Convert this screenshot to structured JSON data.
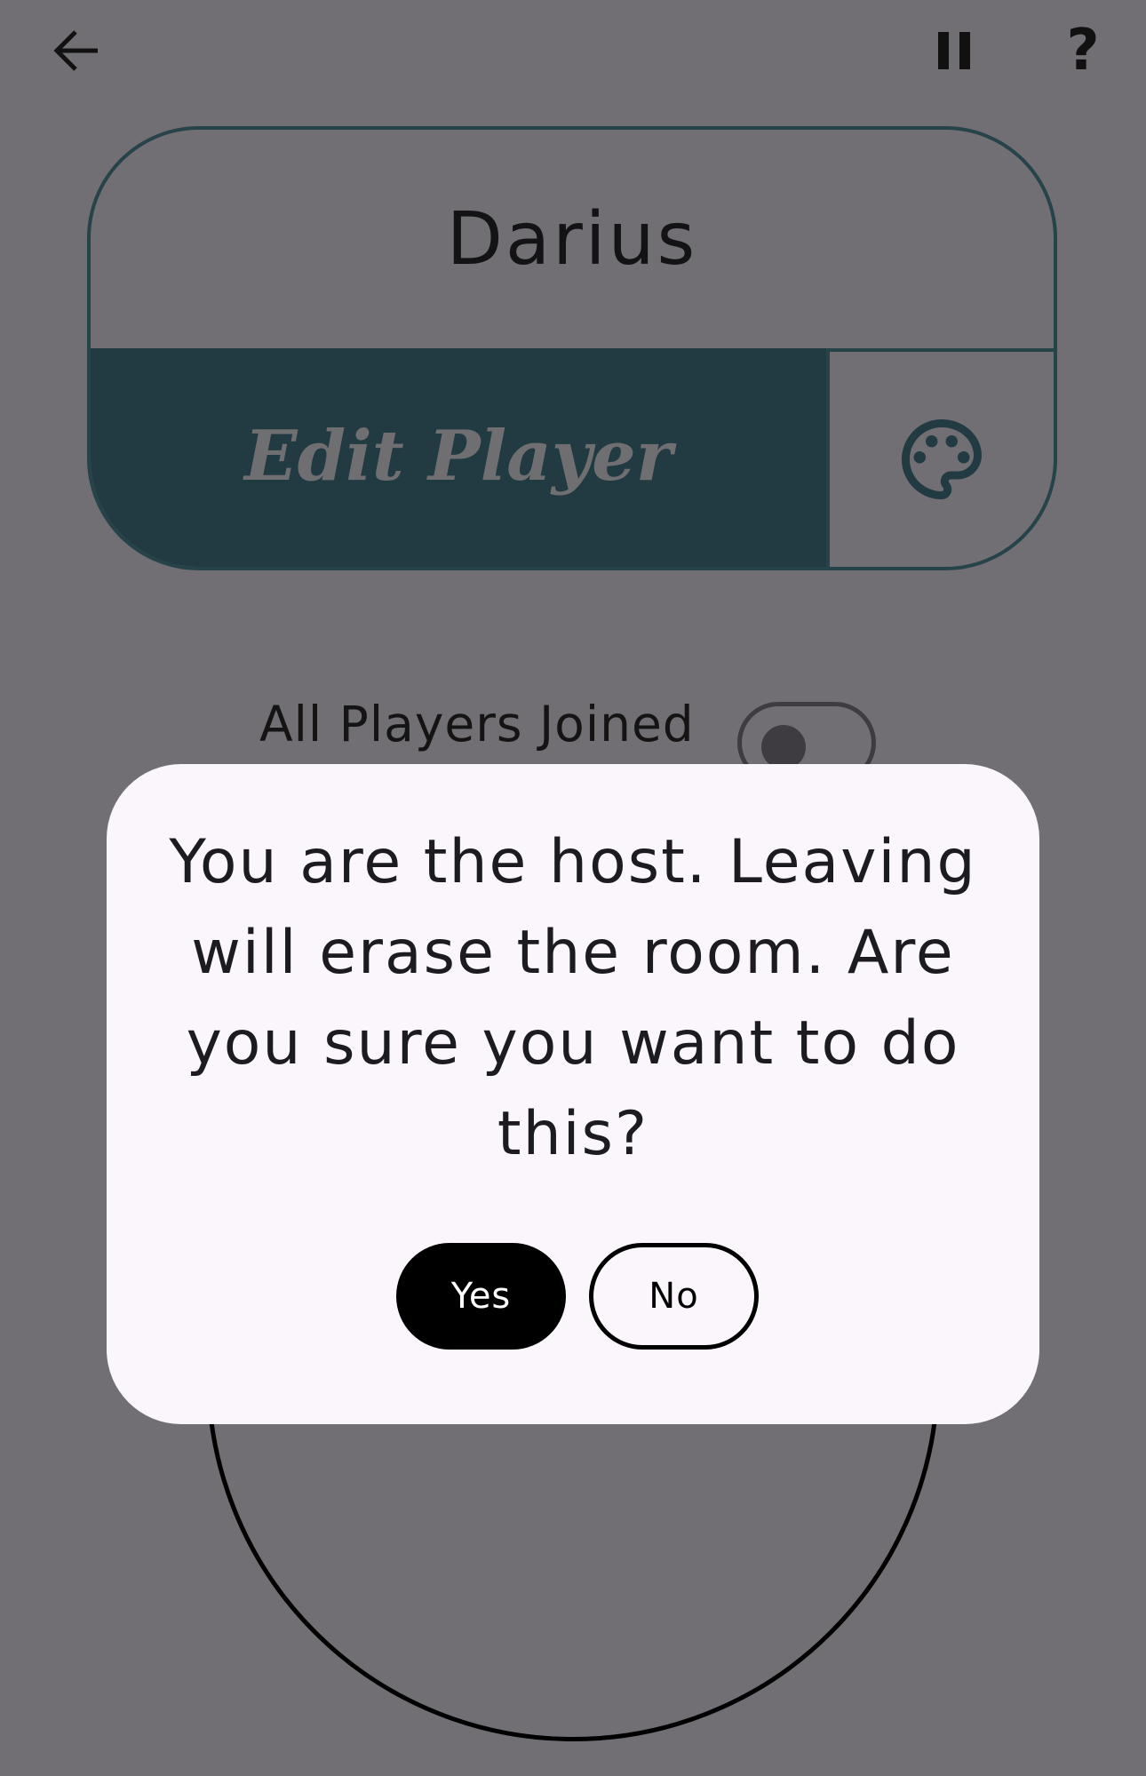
{
  "topbar": {
    "back_icon": "arrow-left-icon",
    "pause_icon": "pause-icon",
    "help_label": "?"
  },
  "player_card": {
    "name": "Darius",
    "edit_label": "Edit Player",
    "palette_icon": "palette-icon",
    "accent_color": "#223a42"
  },
  "lobby": {
    "all_players_joined_label": "All Players Joined",
    "all_players_joined_on": false
  },
  "dialog": {
    "message": "You are the host. Leaving will erase the room. Are you sure you want to do this?",
    "yes_label": "Yes",
    "no_label": "No"
  }
}
